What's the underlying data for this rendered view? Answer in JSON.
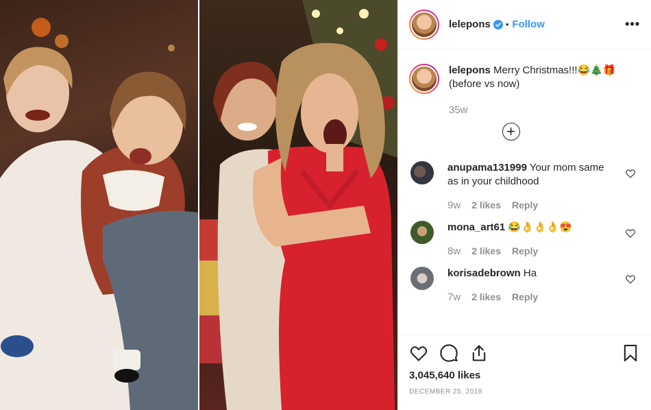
{
  "photo": {
    "alt_left": "Before photo",
    "alt_right": "Now photo"
  },
  "header": {
    "username": "lelepons",
    "dot": "•",
    "follow_label": "Follow",
    "more_icon": "more-options-icon"
  },
  "caption": {
    "username": "lelepons",
    "text": "Merry Christmas!!!😂🎄🎁 (before vs now)",
    "time": "35w"
  },
  "load_more": "+",
  "comments": [
    {
      "username": "anupama131999",
      "text": "Your mom same as in your childhood",
      "time": "9w",
      "likes": "2 likes",
      "reply": "Reply"
    },
    {
      "username": "mona_art61",
      "text": "😂👌👌👌😍",
      "time": "8w",
      "likes": "2 likes",
      "reply": "Reply"
    },
    {
      "username": "korisadebrown",
      "text": "Ha",
      "time": "7w",
      "likes": "2 likes",
      "reply": "Reply"
    }
  ],
  "post": {
    "likes": "3,045,640 likes",
    "date": "December 25, 2018"
  },
  "colors": {
    "link": "#3897f0",
    "muted": "#8e8e8e",
    "text": "#262626"
  }
}
